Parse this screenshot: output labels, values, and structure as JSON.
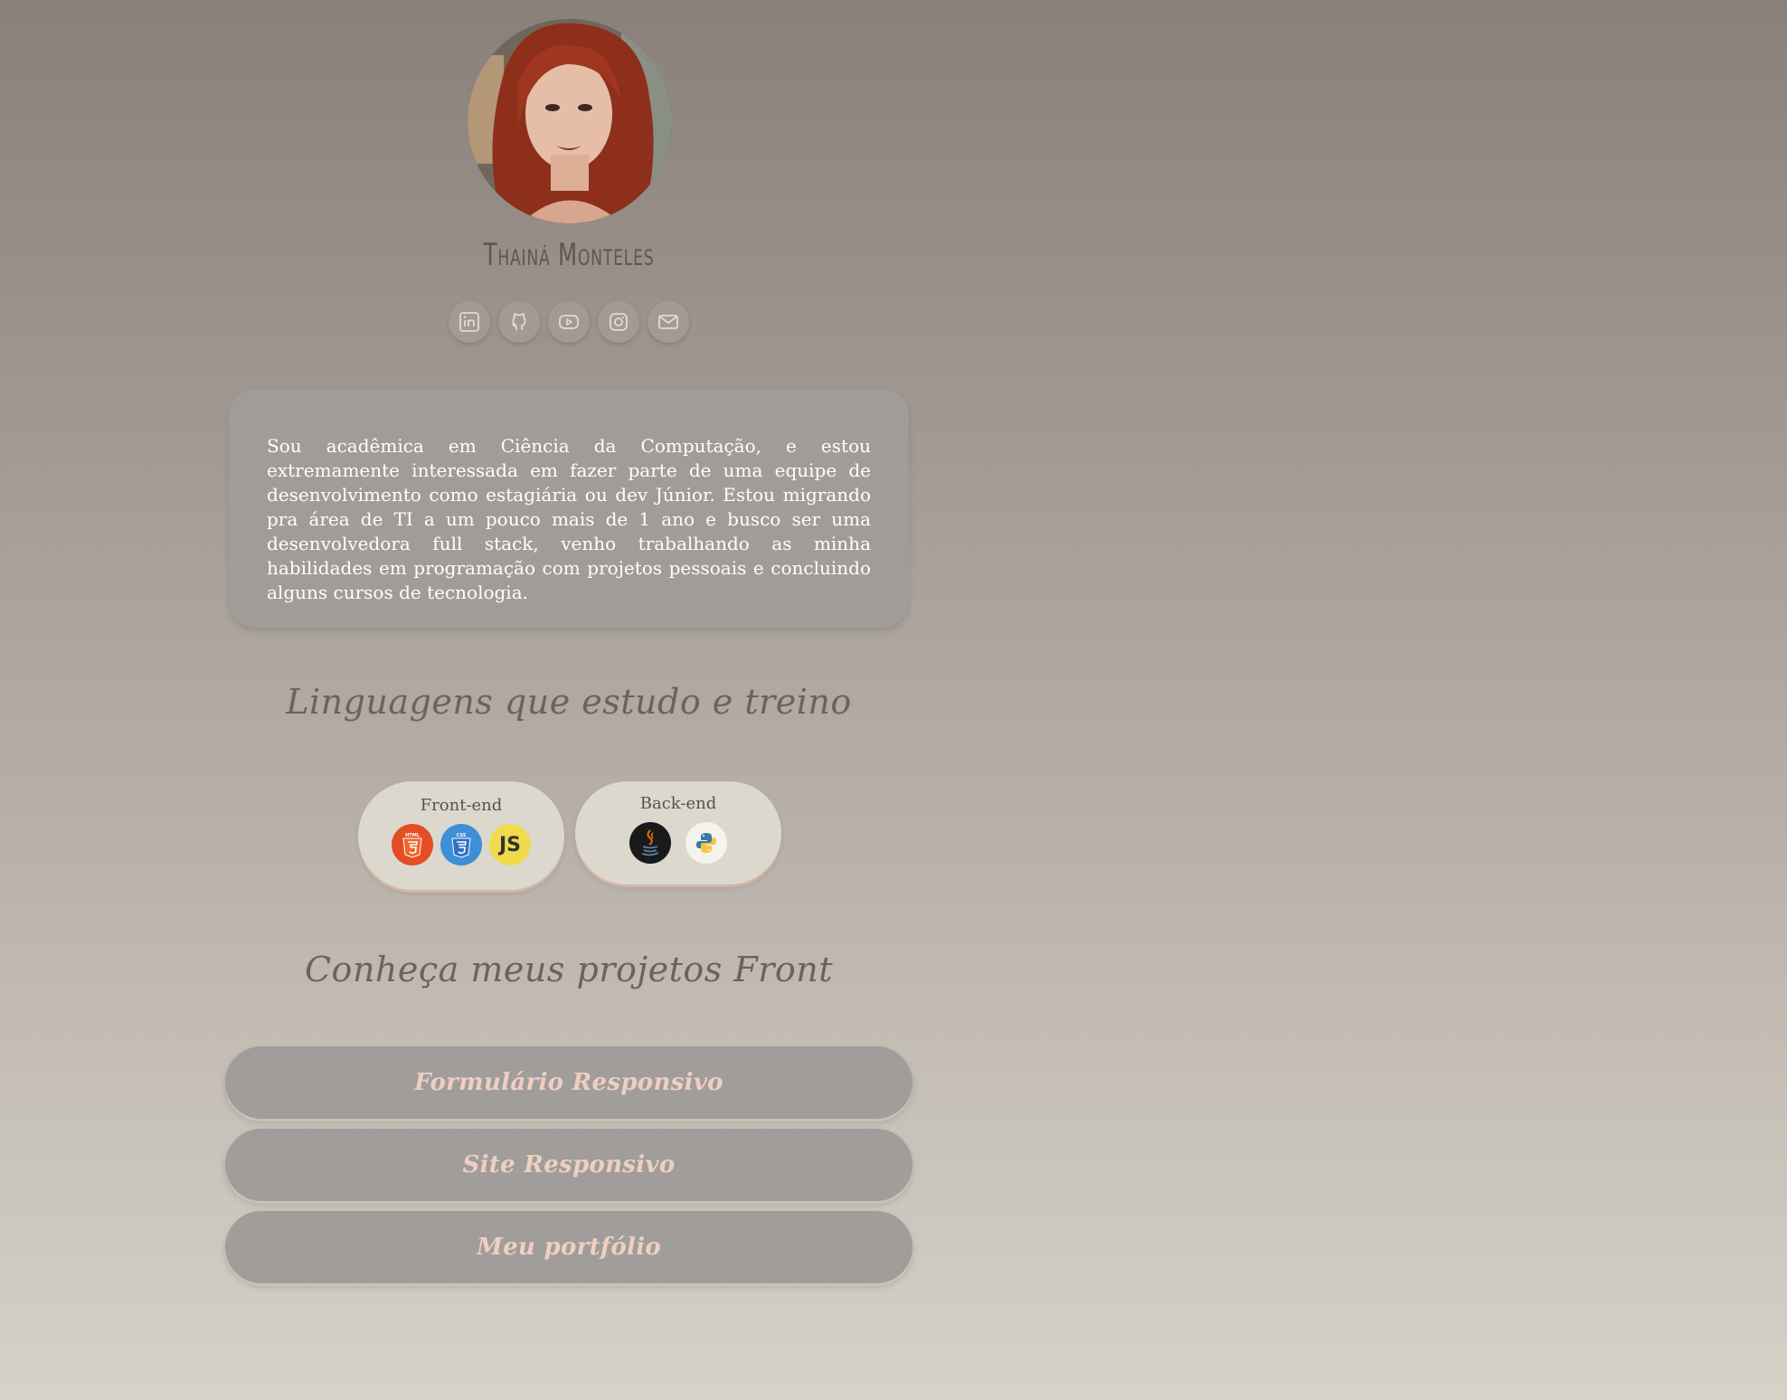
{
  "profile": {
    "name": "Thainá Monteles"
  },
  "socials": [
    {
      "icon": "linkedin-icon"
    },
    {
      "icon": "github-icon"
    },
    {
      "icon": "youtube-icon"
    },
    {
      "icon": "instagram-icon"
    },
    {
      "icon": "mail-icon"
    }
  ],
  "about": {
    "text": "Sou acadêmica em Ciência da Computação, e estou extremamente interessada em fazer parte de uma equipe de desenvolvimento como estagiária ou dev Júnior. Estou migrando pra área de TI a um pouco mais de 1 ano e busco ser uma desenvolvedora full stack, venho trabalhando as minha habilidades em programação com projetos pessoais e concluindo alguns cursos de tecnologia."
  },
  "languages": {
    "title": "Linguagens que estudo e treino",
    "frontend": {
      "label": "Front-end",
      "icons": [
        "html5-icon",
        "css3-icon",
        "javascript-icon"
      ]
    },
    "backend": {
      "label": "Back-end",
      "icons": [
        "java-icon",
        "python-icon"
      ]
    }
  },
  "projects": {
    "title": "Conheça meus projetos Front",
    "items": [
      {
        "label": "Formulário Responsivo"
      },
      {
        "label": "Site Responsivo"
      },
      {
        "label": "Meu portfólio"
      }
    ]
  },
  "colors": {
    "background_top": "#8a807b",
    "background_bottom": "#d6d2c8",
    "card": "#a09d99",
    "pill": "#dcd8ce",
    "button_text": "#efcfc2",
    "heading": "#6e625b"
  }
}
